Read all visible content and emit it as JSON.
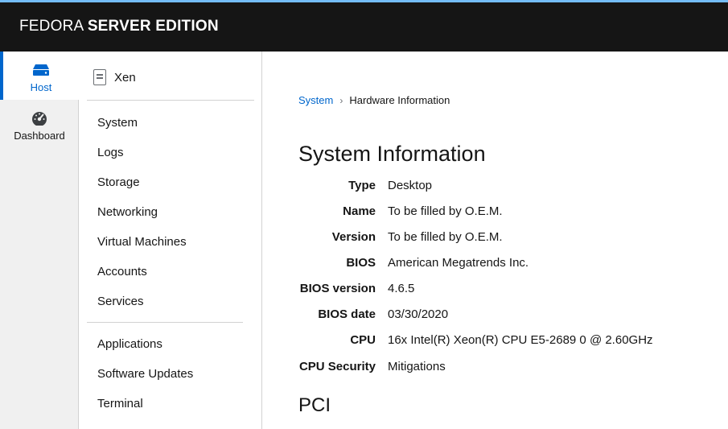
{
  "brand": {
    "part1": "FEDORA",
    "part2": "SERVER EDITION"
  },
  "railnav": [
    {
      "label": "Host",
      "icon": "server-icon",
      "active": true
    },
    {
      "label": "Dashboard",
      "icon": "dashboard-gauge-icon",
      "active": false
    }
  ],
  "host": {
    "name": "Xen",
    "icon": "document-icon"
  },
  "menu": {
    "group1": [
      "System",
      "Logs",
      "Storage",
      "Networking",
      "Virtual Machines",
      "Accounts",
      "Services"
    ],
    "group2": [
      "Applications",
      "Software Updates",
      "Terminal"
    ]
  },
  "breadcrumb": {
    "parent": "System",
    "separator": "›",
    "current": "Hardware Information"
  },
  "system_info": {
    "title": "System Information",
    "rows": [
      {
        "key": "Type",
        "value": "Desktop"
      },
      {
        "key": "Name",
        "value": "To be filled by O.E.M."
      },
      {
        "key": "Version",
        "value": "To be filled by O.E.M."
      },
      {
        "key": "BIOS",
        "value": "American Megatrends Inc."
      },
      {
        "key": "BIOS version",
        "value": "4.6.5"
      },
      {
        "key": "BIOS date",
        "value": "03/30/2020"
      },
      {
        "key": "CPU",
        "value": "16x Intel(R) Xeon(R) CPU E5-2689 0 @ 2.60GHz"
      },
      {
        "key": "CPU Security",
        "value": "Mitigations"
      }
    ]
  },
  "pci": {
    "title": "PCI"
  },
  "colors": {
    "accent": "#0066cc",
    "topbar": "#151515",
    "topbar_border": "#73bcf7"
  }
}
